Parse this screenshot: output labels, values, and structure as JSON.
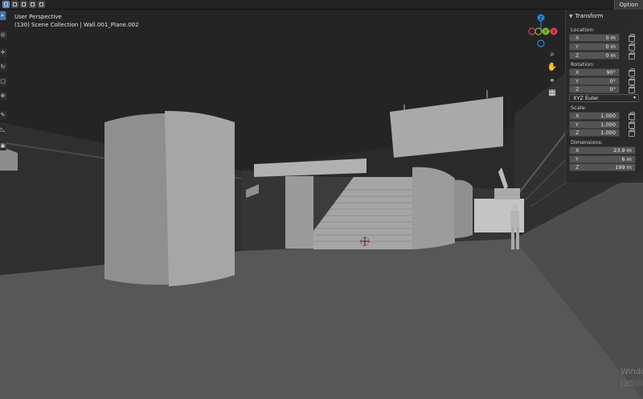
{
  "header": {
    "modes": [
      "select-box",
      "select-extend",
      "select-subtract",
      "select-invert",
      "select-intersect"
    ],
    "options_label": "Option"
  },
  "viewport": {
    "title": "User Perspective",
    "subtitle": "(130) Scene Collection | Wall.001_Plane.002"
  },
  "toolbar": {
    "tools": [
      {
        "icon": "select-icon",
        "glyph": "▸"
      },
      {
        "icon": "cursor-icon",
        "glyph": "◎"
      },
      {
        "icon": "move-icon",
        "glyph": "✛"
      },
      {
        "icon": "rotate-icon",
        "glyph": "↻"
      },
      {
        "icon": "scale-icon",
        "glyph": "▢"
      },
      {
        "icon": "transform-icon",
        "glyph": "⊕"
      },
      {
        "icon": "annotate-icon",
        "glyph": "✎"
      },
      {
        "icon": "measure-icon",
        "glyph": "◺"
      },
      {
        "icon": "add-cube-icon",
        "glyph": "▣"
      }
    ]
  },
  "gizmo": {
    "axis_labels": {
      "z": "Z",
      "y": "Y",
      "x": "X"
    },
    "colors": {
      "x": "#e0405a",
      "y": "#7cba2f",
      "z": "#2f83d6"
    }
  },
  "nav_buttons": [
    "zoom-icon",
    "hand-icon",
    "camera-icon",
    "grid-icon"
  ],
  "panel": {
    "title": "Transform",
    "location_label": "Location:",
    "location": [
      {
        "axis": "X",
        "value": "0 m"
      },
      {
        "axis": "Y",
        "value": "0 m"
      },
      {
        "axis": "Z",
        "value": "0 m"
      }
    ],
    "rotation_label": "Rotation:",
    "rotation": [
      {
        "axis": "X",
        "value": "90°"
      },
      {
        "axis": "Y",
        "value": "0°"
      },
      {
        "axis": "Z",
        "value": "0°"
      }
    ],
    "rotation_mode": "XYZ Euler",
    "scale_label": "Scale:",
    "scale": [
      {
        "axis": "X",
        "value": "1.000"
      },
      {
        "axis": "Y",
        "value": "1.000"
      },
      {
        "axis": "Z",
        "value": "1.000"
      }
    ],
    "dimensions_label": "Dimensions:",
    "dimensions": [
      {
        "axis": "X",
        "value": "23.9 m"
      },
      {
        "axis": "Y",
        "value": "6 m"
      },
      {
        "axis": "Z",
        "value": "199 m"
      }
    ]
  },
  "watermark": {
    "line1": "Windo",
    "line2": "[설정]으"
  },
  "colors": {
    "accent": "#4772b3",
    "floor": "#575757",
    "wall": "#2d2d2d",
    "ceiling": "#222222",
    "object": "#9a9a9a"
  }
}
